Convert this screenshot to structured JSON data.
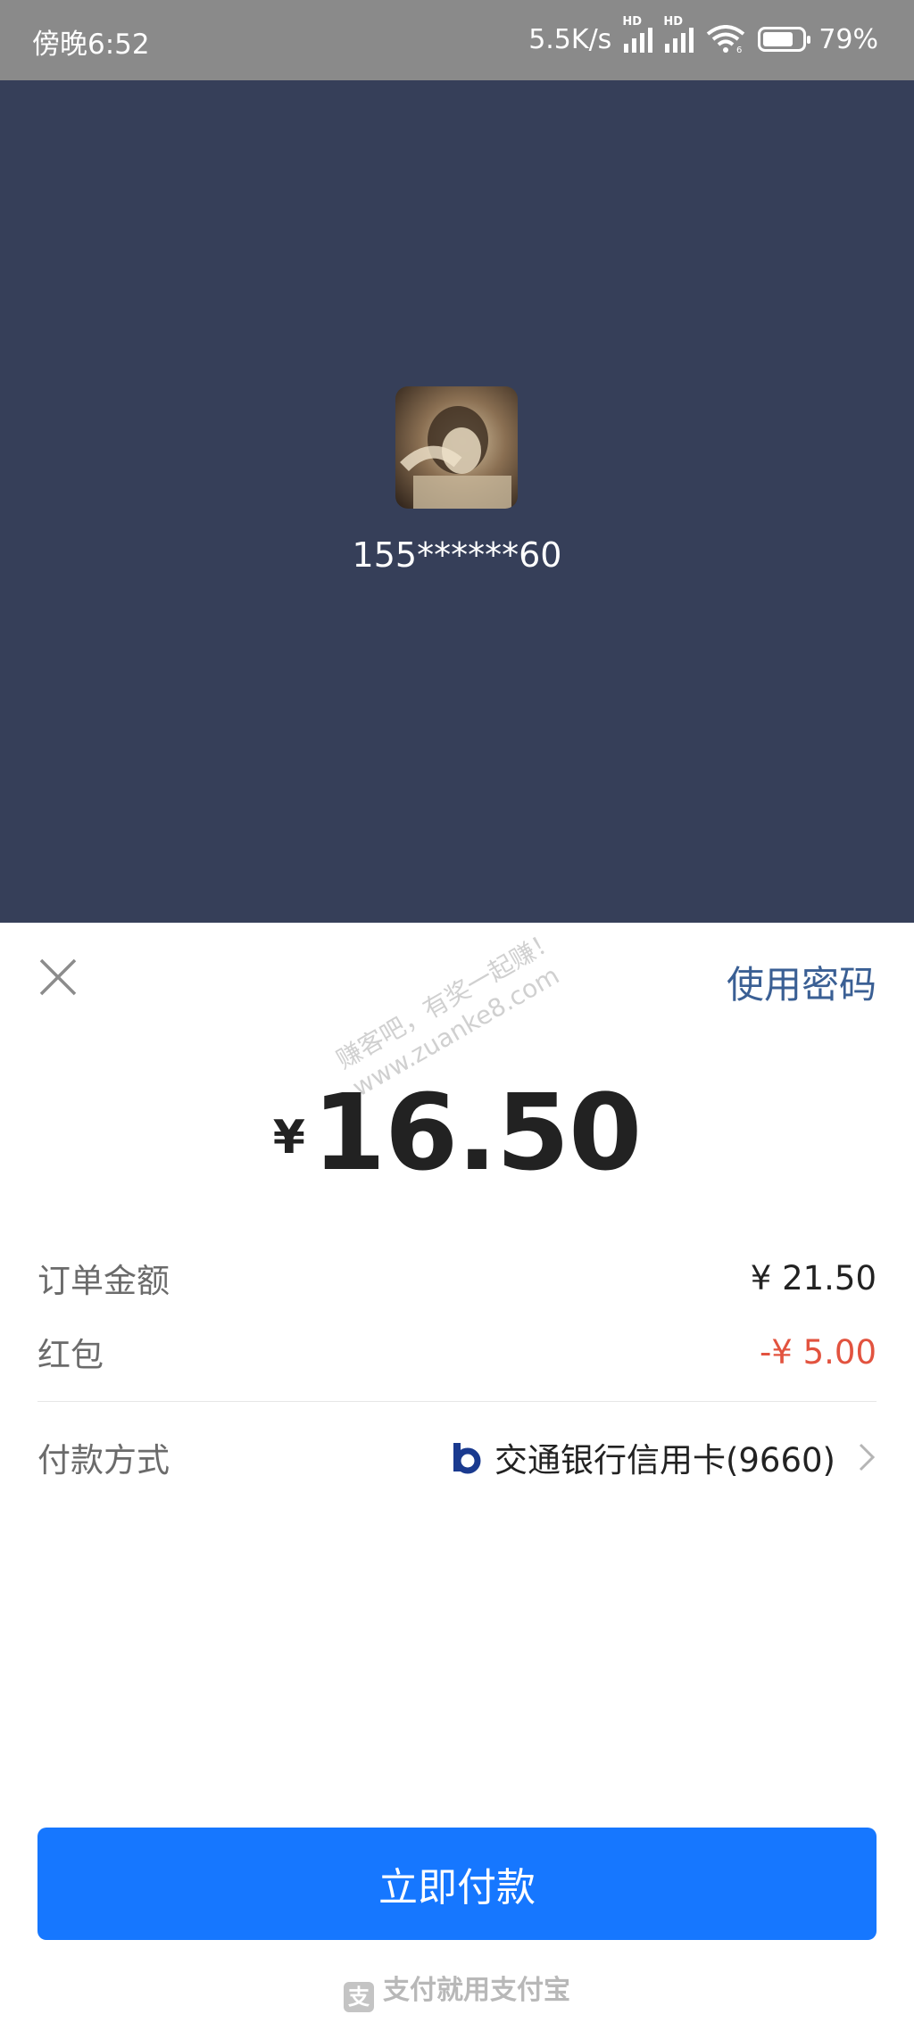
{
  "status_bar": {
    "time": "傍晚6:52",
    "net_speed": "5.5K/s",
    "sim1_tag": "HD",
    "sim2_tag": "HD",
    "wifi_tag": "6",
    "battery_percent": "79%",
    "battery_level": 0.79
  },
  "merchant": {
    "account": "155******60"
  },
  "header": {
    "use_password_label": "使用密码"
  },
  "watermark": {
    "line1": "赚客吧，有奖一起赚！",
    "line2": "www.zuanke8.com"
  },
  "payment": {
    "currency_symbol": "¥",
    "amount": "16.50",
    "order_amount_label": "订单金额",
    "order_amount_value": "¥ 21.50",
    "red_packet_label": "红包",
    "red_packet_value": "-¥ 5.00",
    "method_label": "付款方式",
    "method_value": "交通银行信用卡(9660)"
  },
  "actions": {
    "pay_button_label": "立即付款"
  },
  "footer": {
    "text": "支付就用支付宝",
    "icon_text": "支"
  },
  "colors": {
    "hero_bg": "#363f59",
    "accent": "#1677ff",
    "link": "#3a5f94",
    "discount_red": "#e2533f"
  }
}
